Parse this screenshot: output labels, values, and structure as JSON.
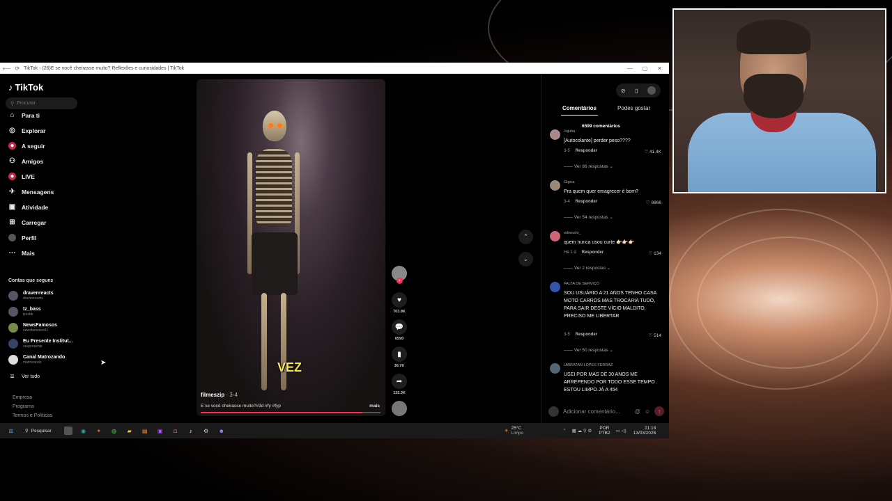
{
  "browser": {
    "tab_title": "TikTok - (26)E se você cheirasse muito? Reflexões e curiosidades | TikTok"
  },
  "sidebar": {
    "logo": "TikTok",
    "search_placeholder": "Procurar",
    "nav": [
      {
        "label": "Para ti",
        "icon": "home-icon"
      },
      {
        "label": "Explorar",
        "icon": "compass-icon"
      },
      {
        "label": "A seguir",
        "icon": "following-icon"
      },
      {
        "label": "Amigos",
        "icon": "friends-icon"
      },
      {
        "label": "LIVE",
        "icon": "live-icon"
      },
      {
        "label": "Mensagens",
        "icon": "messages-icon"
      },
      {
        "label": "Atividade",
        "icon": "activity-icon"
      },
      {
        "label": "Carregar",
        "icon": "upload-icon"
      },
      {
        "label": "Perfil",
        "icon": "profile-icon"
      },
      {
        "label": "Mais",
        "icon": "more-icon"
      }
    ],
    "following_title": "Contas que segues",
    "following": [
      {
        "name": "dravenreacts",
        "handle": "dravenreacts"
      },
      {
        "name": "tz_bass",
        "handle": "tzssbb"
      },
      {
        "name": "NewsFamosos",
        "handle": "newsfamosos01"
      },
      {
        "name": "Eu Presente Institut...",
        "handle": "oeupresente"
      },
      {
        "name": "Canal Matrozando",
        "handle": "matrozando"
      }
    ],
    "see_all": "Ver tudo",
    "footer": [
      "Empresa",
      "Programa",
      "Termos e Políticas"
    ]
  },
  "video": {
    "caption_word": "VEZ",
    "author": "filmeszip",
    "date": "· 3-4",
    "description": "E se você cheirasse muito?#3d #fy #fyp",
    "more": "mais",
    "progress": 0.9
  },
  "actions": {
    "likes": "703.8K",
    "comments": "6599",
    "saves": "36.7K",
    "shares": "132.3K"
  },
  "comments_panel": {
    "tab_comments": "Comentários",
    "tab_likes": "Podes gostar",
    "count_label": "6599 comentários",
    "items": [
      {
        "user": "Jujuba",
        "text": "[Autocolante] perder peso????",
        "date": "3-5",
        "reply": "Responder",
        "likes": "41.4K",
        "replies": "Ver 86 respostas"
      },
      {
        "user": "Gigica",
        "text": "Pra quem quer emagrecer é bom?",
        "date": "3-4",
        "reply": "Responder",
        "likes": "8866",
        "replies": "Ver 54 respostas"
      },
      {
        "user": "edneudo_",
        "text": "quem nunca usou curte 👉🏻👉🏻👉🏻",
        "date": "Há 1 d",
        "reply": "Responder",
        "likes": "134",
        "replies": "Ver 2 respostas"
      },
      {
        "user": "FALTA DE SERVIÇO",
        "text": "SOU USUÁRIO A 21 ANOS TENHO CASA MOTO CARROS MAS TROCARIA TUDO, PARA SAIR DESTE VÍCIO MALDITO, PRECISO ME LIBERTAR",
        "date": "3-5",
        "reply": "Responder",
        "likes": "514",
        "replies": "Ver 50 respostas"
      },
      {
        "user": "UBIRATAN LOPES FERRAZ",
        "text": "USEI POR MAS DE 30 ANOS ME ARREPENDO POR TODO ESSE TEMPO . ESTOU LIMPO JÁ A 454"
      }
    ],
    "add_placeholder": "Adicionar comentário..."
  },
  "taskbar": {
    "search": "Pesquisar",
    "weather_temp": "25°C",
    "weather_desc": "Limpo",
    "lang": "POR",
    "layout": "PTB2",
    "time": "21:18",
    "date": "13/03/2026"
  }
}
